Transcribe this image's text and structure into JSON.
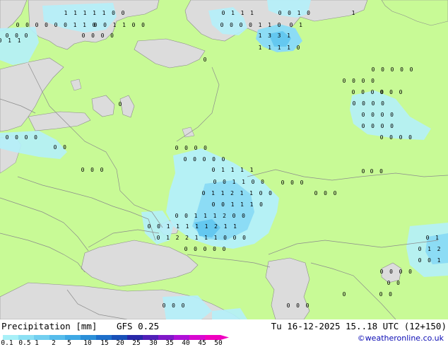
{
  "legend": {
    "title": "Precipitation [mm]",
    "model": "GFS 0.25",
    "valid_time": "Tu 16-12-2025 15..18 UTC (12+150)",
    "copyright": "©weatheronline.co.uk",
    "scale_values": [
      "0.1",
      "0.5",
      "1",
      "2",
      "5",
      "10",
      "15",
      "20",
      "25",
      "30",
      "35",
      "40",
      "45",
      "50"
    ],
    "scale_colors": [
      "#a8f0f8",
      "#8ce0f4",
      "#72cff0",
      "#56bceb",
      "#3ea8e4",
      "#2b8fd8",
      "#1e6fca",
      "#1850b8",
      "#2828a8",
      "#5020b8",
      "#8018c8",
      "#b010d8",
      "#d808d0",
      "#f000c0"
    ]
  },
  "colors": {
    "land": "#c8fa96",
    "sea": "#dcdcdc",
    "precip_light": "#b4f0fa",
    "precip_mid": "#8cdcf5",
    "precip_strong": "#64c8f0",
    "border": "#8c8c8c",
    "marker": "#000000"
  },
  "precip_values": [
    [
      "1",
      "1",
      "1",
      "1",
      "1",
      "0",
      "0"
    ],
    [
      "0",
      "1",
      "1",
      "1"
    ],
    [
      "0",
      "0",
      "1",
      "0"
    ],
    [
      "1"
    ],
    [
      "0",
      "0",
      "0",
      "0",
      "0",
      "0",
      "1",
      "1",
      "0"
    ],
    [
      "0",
      "0",
      "1",
      "1",
      "0",
      "0"
    ],
    [
      "0",
      "1"
    ],
    [
      "0",
      "0",
      "0",
      "0",
      "1",
      "1",
      "0"
    ],
    [
      "0",
      "0",
      "0"
    ],
    [
      "1",
      "3",
      "3",
      "1"
    ],
    [
      "0",
      "0",
      "0",
      "0"
    ],
    [
      "1",
      "1",
      "1",
      "1",
      "0"
    ],
    [
      "0"
    ],
    [
      "0"
    ],
    [
      "0",
      "0",
      "0",
      "0"
    ],
    [
      "0",
      "0"
    ],
    [
      "0",
      "0",
      "0",
      "0"
    ],
    [
      "0",
      "0",
      "0",
      "0",
      "0"
    ],
    [
      "0",
      "1",
      "1",
      "1",
      "1"
    ],
    [
      "0",
      "0",
      "0"
    ],
    [
      "0",
      "0",
      "0",
      "0"
    ],
    [
      "0",
      "0",
      "0",
      "0",
      "0"
    ],
    [
      "0",
      "0",
      "0"
    ],
    [
      "0",
      "0",
      "0",
      "0"
    ],
    [
      "0",
      "0",
      "0",
      "0"
    ],
    [
      "0",
      "0",
      "0",
      "0"
    ],
    [
      "0"
    ],
    [
      "0",
      "0",
      "0"
    ],
    [
      "0",
      "0",
      "1",
      "1",
      "0",
      "0"
    ],
    [
      "0",
      "1",
      "1",
      "2",
      "1",
      "1",
      "0",
      "0"
    ],
    [
      "0",
      "0",
      "0"
    ],
    [
      "0",
      "0",
      "1",
      "1",
      "1",
      "0"
    ],
    [
      "0",
      "0",
      "1",
      "1",
      "1",
      "2",
      "0",
      "0"
    ],
    [
      "0",
      "0",
      "1",
      "1",
      "1",
      "1",
      "1",
      "2",
      "1",
      "1"
    ],
    [
      "0",
      "1",
      "2",
      "2",
      "1",
      "1",
      "1",
      "0",
      "0",
      "0"
    ],
    [
      "0",
      "0",
      "0",
      "0",
      "0"
    ],
    [
      "0",
      "0"
    ],
    [
      "0",
      "0",
      "0",
      "0"
    ],
    [
      "0",
      "0",
      "0",
      "0"
    ],
    [
      "0",
      "1",
      "2",
      "0",
      "0",
      "1"
    ],
    [
      "0",
      "0"
    ],
    [
      "0"
    ],
    [
      "0",
      "0"
    ],
    [
      "0",
      "0",
      "0"
    ],
    [
      "0",
      "0",
      "0"
    ],
    [
      "0",
      "0",
      "0",
      "0",
      "0",
      "0"
    ],
    [
      "0",
      "0",
      "0",
      "0"
    ],
    [
      "0",
      "1"
    ],
    [
      "0",
      "0",
      "1",
      "2"
    ],
    [
      "0",
      "1",
      "1"
    ]
  ]
}
